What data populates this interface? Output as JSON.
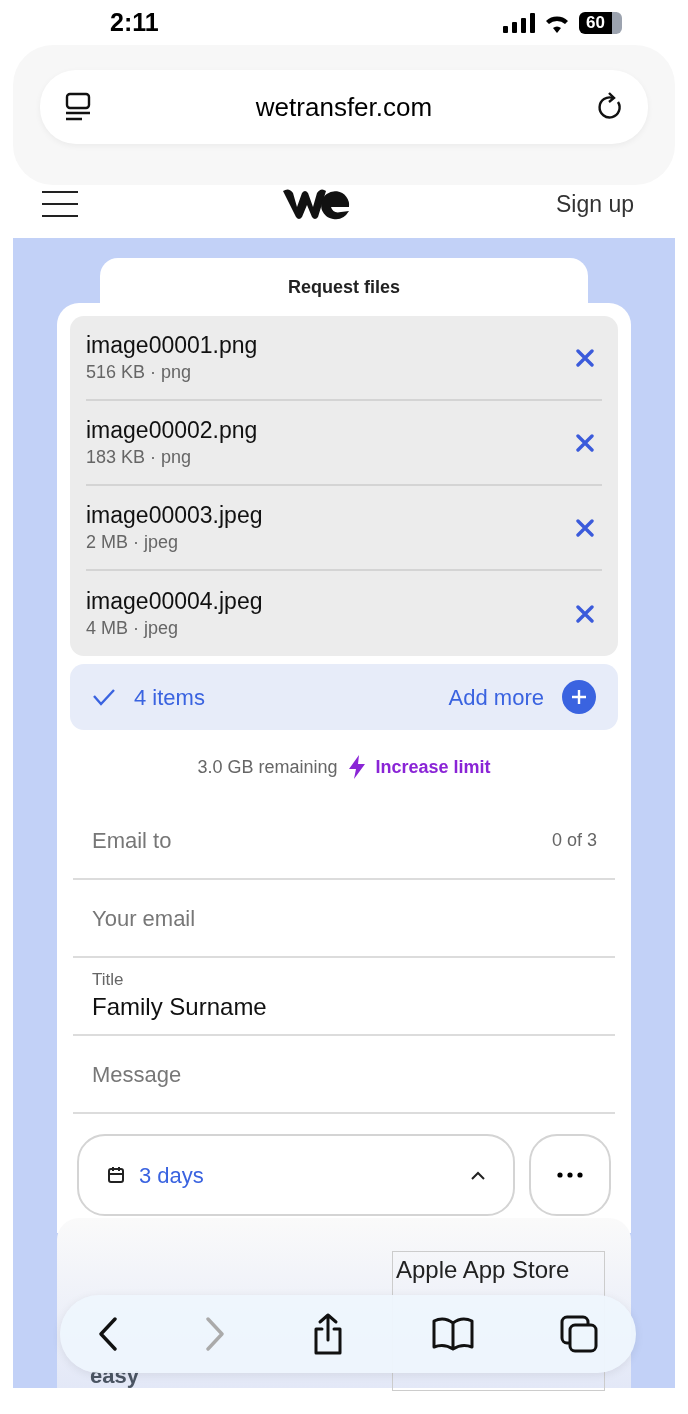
{
  "status_bar": {
    "time": "2:11",
    "battery": "60"
  },
  "browser": {
    "url": "wetransfer.com"
  },
  "site_nav": {
    "sign_up": "Sign up"
  },
  "tab": {
    "label": "Request files"
  },
  "files": [
    {
      "name": "image00001.png",
      "meta": "516 KB · png"
    },
    {
      "name": "image00002.png",
      "meta": "183 KB · png"
    },
    {
      "name": "image00003.jpeg",
      "meta": "2 MB · jpeg"
    },
    {
      "name": "image00004.jpeg",
      "meta": "4 MB · jpeg"
    }
  ],
  "summary": {
    "count": "4 items",
    "add_more": "Add more"
  },
  "quota": {
    "remaining": "3.0 GB remaining",
    "upgrade": "Increase limit"
  },
  "fields": [
    {
      "kind": "counter",
      "placeholder": "Email to",
      "counter": "0 of 3"
    },
    {
      "kind": "plain",
      "placeholder": "Your email"
    },
    {
      "kind": "labeled",
      "label": "Title",
      "value": "Family Surname"
    },
    {
      "kind": "plain",
      "placeholder": "Message"
    }
  ],
  "expiry": {
    "label": "3 days"
  },
  "below": {
    "store_label": "Apple App Store",
    "heading_tail": "easy"
  }
}
